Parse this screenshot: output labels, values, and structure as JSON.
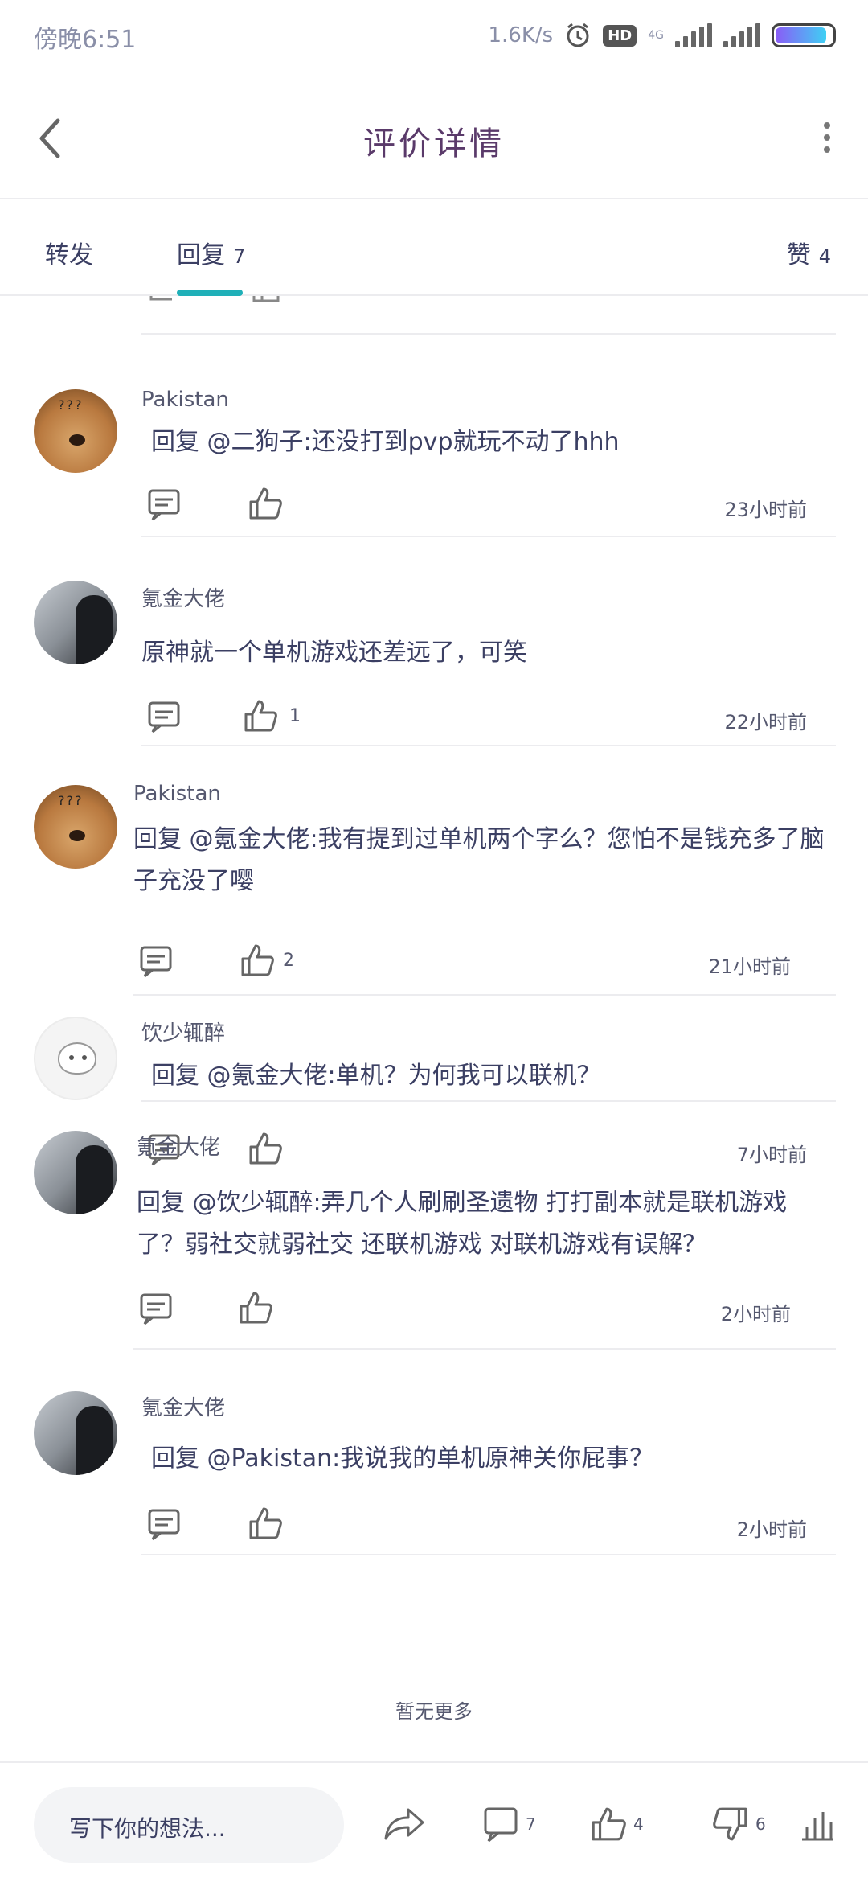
{
  "status_bar": {
    "time": "傍晚6:51",
    "network_speed": "1.6K/s",
    "hd_label": "HD",
    "network_type": "4G",
    "battery_level": 0.9
  },
  "header": {
    "title": "评价详情"
  },
  "tabs": {
    "repost_label": "转发",
    "reply_label": "回复",
    "reply_count": "7",
    "likes_label": "赞",
    "likes_count": "4"
  },
  "comments": [
    {
      "username": "Pakistan",
      "avatar": "dog-avatar",
      "text": "回复 @二狗子:还没打到pvp就玩不动了hhh",
      "likes": "",
      "time": "23小时前"
    },
    {
      "username": "氪金大佬",
      "avatar": "man-avatar",
      "text": "原神就一个单机游戏还差远了，可笑",
      "likes": "1",
      "time": "22小时前"
    },
    {
      "username": "Pakistan",
      "avatar": "dog-avatar",
      "text": "回复 @氪金大佬:我有提到过单机两个字么？您怕不是钱充多了脑子充没了嘤",
      "likes": "2",
      "time": "21小时前"
    },
    {
      "username": "饮少辄醉",
      "avatar": "cat-avatar",
      "text": "回复 @氪金大佬:单机？为何我可以联机？",
      "likes": "",
      "time": "7小时前"
    },
    {
      "username": "氪金大佬",
      "avatar": "man-avatar",
      "text": "回复 @饮少辄醉:弄几个人刷刷圣遗物 打打副本就是联机游戏了？弱社交就弱社交 还联机游戏 对联机游戏有误解？",
      "likes": "",
      "time": "2小时前"
    },
    {
      "username": "氪金大佬",
      "avatar": "man-avatar",
      "text": "回复 @Pakistan:我说我的单机原神关你屁事？",
      "likes": "",
      "time": "2小时前"
    }
  ],
  "no_more_text": "暂无更多",
  "bottom_bar": {
    "input_placeholder": "写下你的想法...",
    "comments_count": "7",
    "likes_count": "4",
    "dislikes_count": "6"
  },
  "colors": {
    "accent": "#1fb0b8",
    "text": "#3b3f63",
    "divider": "#ececef"
  }
}
